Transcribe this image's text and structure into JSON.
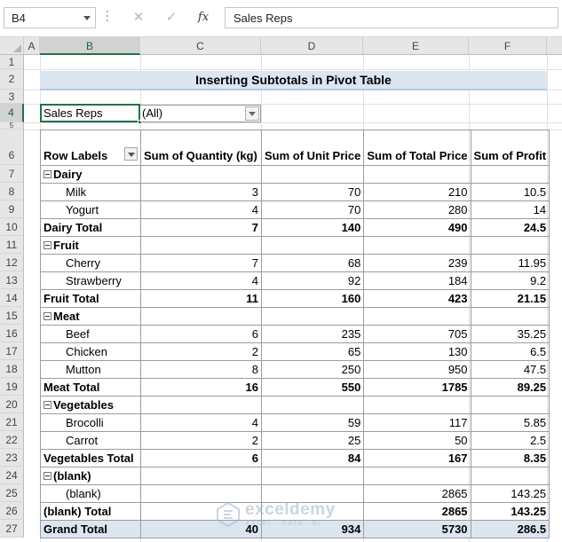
{
  "formula_bar": {
    "name_box": "B4",
    "cancel_icon": "✕",
    "enter_icon": "✓",
    "fx_label": "fx",
    "formula": "Sales Reps"
  },
  "columns": [
    "A",
    "B",
    "C",
    "D",
    "E",
    "F"
  ],
  "rows": [
    "1",
    "2",
    "3",
    "4",
    "5",
    "6",
    "7",
    "8",
    "9",
    "10",
    "11",
    "12",
    "13",
    "14",
    "15",
    "16",
    "17",
    "18",
    "19",
    "20",
    "21",
    "22",
    "23",
    "24",
    "25",
    "26",
    "27"
  ],
  "title": "Inserting Subtotals in Pivot Table",
  "filter": {
    "label": "Sales Reps",
    "value": "(All)"
  },
  "pivot": {
    "headers": [
      "Row Labels",
      "Sum of Quantity (kg)",
      "Sum of Unit Price",
      "Sum of Total Price",
      "Sum of Profit"
    ],
    "groups": [
      {
        "name": "Dairy",
        "items": [
          {
            "label": "Milk",
            "qty": "3",
            "unit": "70",
            "total": "210",
            "profit": "10.5"
          },
          {
            "label": "Yogurt",
            "qty": "4",
            "unit": "70",
            "total": "280",
            "profit": "14"
          }
        ],
        "subtotal": {
          "label": "Dairy Total",
          "qty": "7",
          "unit": "140",
          "total": "490",
          "profit": "24.5"
        }
      },
      {
        "name": "Fruit",
        "items": [
          {
            "label": "Cherry",
            "qty": "7",
            "unit": "68",
            "total": "239",
            "profit": "11.95"
          },
          {
            "label": "Strawberry",
            "qty": "4",
            "unit": "92",
            "total": "184",
            "profit": "9.2"
          }
        ],
        "subtotal": {
          "label": "Fruit Total",
          "qty": "11",
          "unit": "160",
          "total": "423",
          "profit": "21.15"
        }
      },
      {
        "name": "Meat",
        "items": [
          {
            "label": "Beef",
            "qty": "6",
            "unit": "235",
            "total": "705",
            "profit": "35.25"
          },
          {
            "label": "Chicken",
            "qty": "2",
            "unit": "65",
            "total": "130",
            "profit": "6.5"
          },
          {
            "label": "Mutton",
            "qty": "8",
            "unit": "250",
            "total": "950",
            "profit": "47.5"
          }
        ],
        "subtotal": {
          "label": "Meat Total",
          "qty": "16",
          "unit": "550",
          "total": "1785",
          "profit": "89.25"
        }
      },
      {
        "name": "Vegetables",
        "items": [
          {
            "label": "Brocolli",
            "qty": "4",
            "unit": "59",
            "total": "117",
            "profit": "5.85"
          },
          {
            "label": "Carrot",
            "qty": "2",
            "unit": "25",
            "total": "50",
            "profit": "2.5"
          }
        ],
        "subtotal": {
          "label": "Vegetables Total",
          "qty": "6",
          "unit": "84",
          "total": "167",
          "profit": "8.35"
        }
      },
      {
        "name": "(blank)",
        "items": [
          {
            "label": "(blank)",
            "qty": "",
            "unit": "",
            "total": "2865",
            "profit": "143.25"
          }
        ],
        "subtotal": {
          "label": "(blank) Total",
          "qty": "",
          "unit": "",
          "total": "2865",
          "profit": "143.25"
        }
      }
    ],
    "grand_total": {
      "label": "Grand Total",
      "qty": "40",
      "unit": "934",
      "total": "5730",
      "profit": "286.5"
    }
  },
  "watermark": {
    "brand": "exceldemy",
    "tagline": "EXCEL · DATA · BI"
  }
}
